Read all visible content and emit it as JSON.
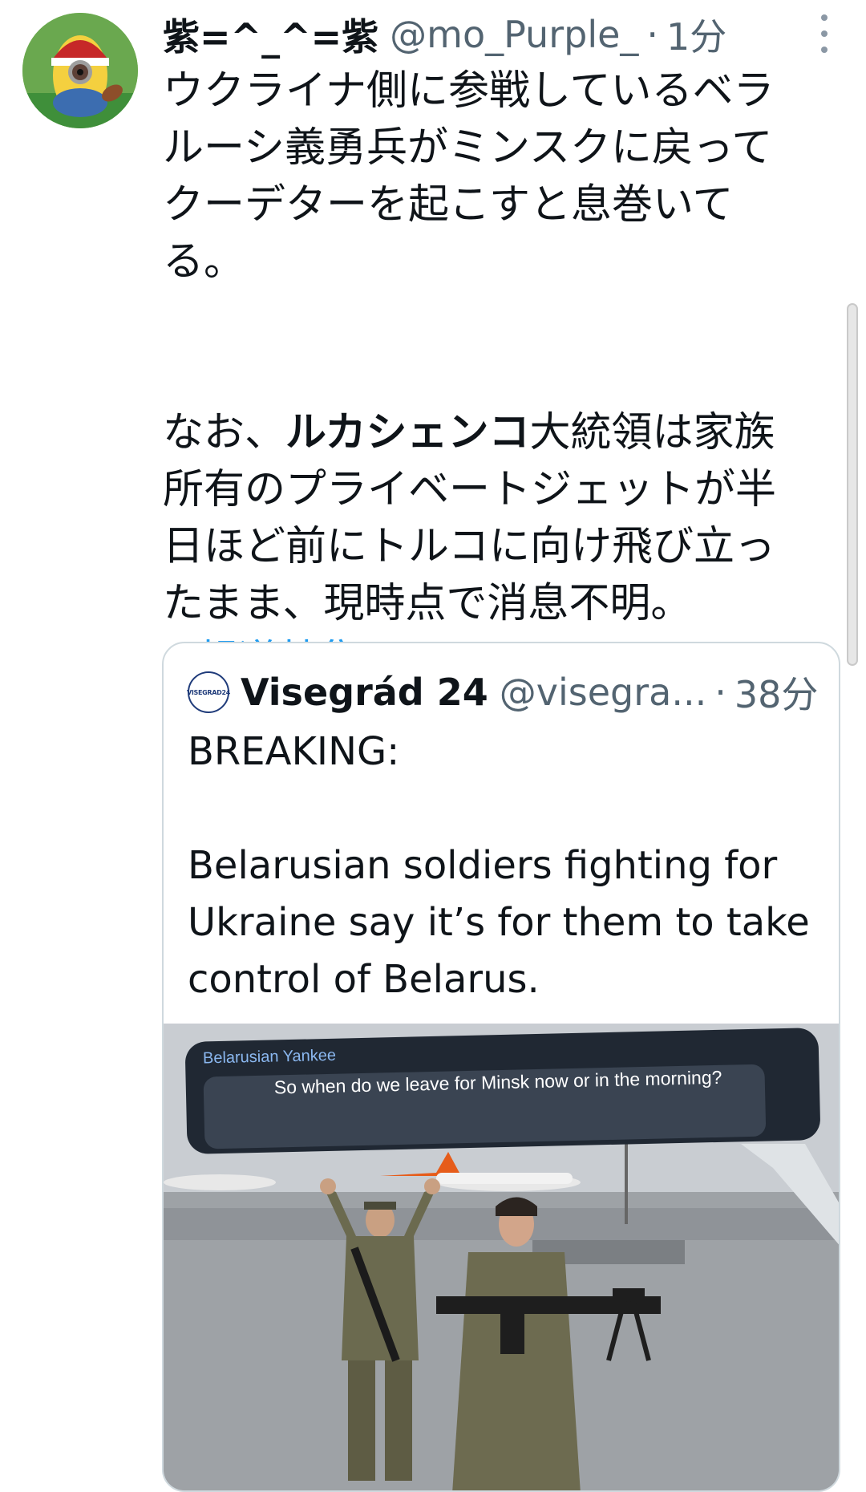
{
  "tweet": {
    "display_name": "紫=^_^=紫",
    "handle": "@mo_Purple_",
    "separator": "·",
    "time": "1分",
    "text_lines": [
      "ウクライナ側に参戦しているベラ",
      "ルーシ義勇兵がミンスクに戻って",
      "クーデターを起こすと息巻いて",
      "る。"
    ],
    "para2_start": "なお、",
    "para2_bold": "ルカシェンコ",
    "para2_after_bold": "大統領は家族",
    "para2_lines": [
      "所有のプライベートジェットが半",
      "日ほど前にトルコに向け飛び立っ",
      "たまま、現時点で消息不明。"
    ],
    "hashtag": "#報道特集"
  },
  "quoted_tweet": {
    "avatar_label": "VISEGRAD24",
    "display_name": "Visegrád 24",
    "handle": "@visegra...",
    "separator": "·",
    "time": "38分",
    "line1": "BREAKING:",
    "line2": "Belarusian soldiers fighting for",
    "line3": "Ukraine say it’s for them to take",
    "line4": "control of Belarus.",
    "media": {
      "chat_sender": "Belarusian Yankee",
      "chat_message": "So when do we leave for Minsk now or in the morning?"
    }
  },
  "icons": {
    "avatar": "minion-football-avatar",
    "more": "more-vertical-icon"
  },
  "colors": {
    "link": "#1d9bf0",
    "secondary_text": "#536471",
    "border": "#cfd9de"
  }
}
